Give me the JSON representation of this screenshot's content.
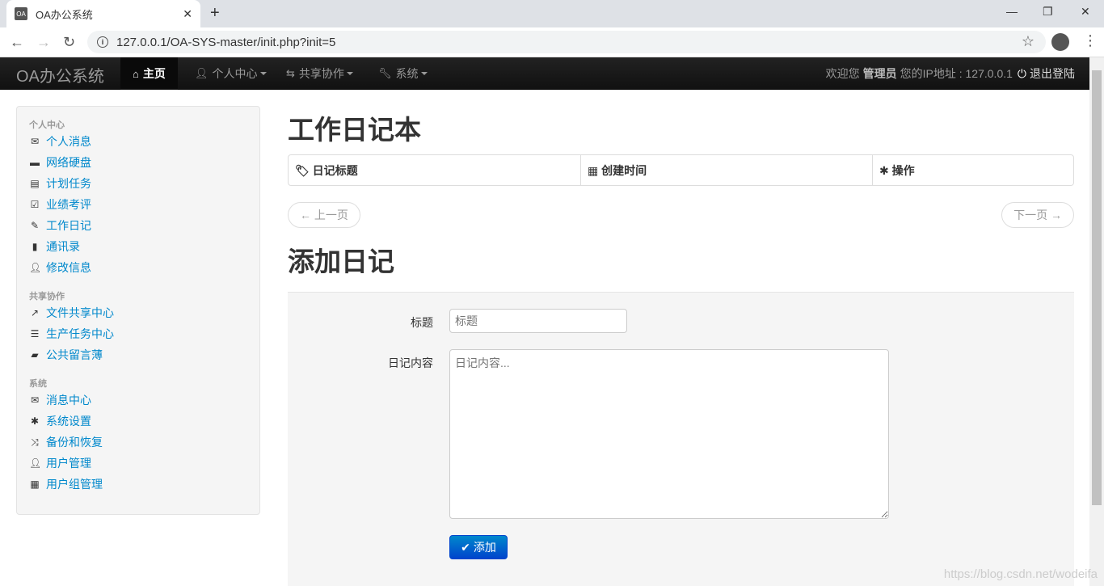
{
  "browser": {
    "tab_title": "OA办公系统",
    "favicon": "OA",
    "url": "127.0.0.1/OA-SYS-master/init.php?init=5"
  },
  "navbar": {
    "brand": "OA办公系统",
    "items": [
      {
        "label": "主页",
        "icon": "home-icon",
        "active": true
      },
      {
        "label": "个人中心",
        "icon": "user-icon"
      },
      {
        "label": "共享协作",
        "icon": "retweet-icon"
      },
      {
        "label": "系统",
        "icon": "wrench-icon"
      }
    ],
    "welcome": "欢迎您",
    "username": "管理员",
    "ip_label": "您的IP地址 : 127.0.0.1",
    "logout": "退出登陆"
  },
  "sidebar": {
    "groups": [
      {
        "header": "个人中心",
        "items": [
          {
            "label": "个人消息",
            "icon": "envelope-icon"
          },
          {
            "label": "网络硬盘",
            "icon": "hdd-icon"
          },
          {
            "label": "计划任务",
            "icon": "list-alt-icon"
          },
          {
            "label": "业绩考评",
            "icon": "check-icon"
          },
          {
            "label": "工作日记",
            "icon": "pencil-icon"
          },
          {
            "label": "通讯录",
            "icon": "book-icon"
          },
          {
            "label": "修改信息",
            "icon": "user-icon"
          }
        ]
      },
      {
        "header": "共享协作",
        "items": [
          {
            "label": "文件共享中心",
            "icon": "share-icon"
          },
          {
            "label": "生产任务中心",
            "icon": "tasks-icon"
          },
          {
            "label": "公共留言薄",
            "icon": "comment-icon"
          }
        ]
      },
      {
        "header": "系统",
        "items": [
          {
            "label": "消息中心",
            "icon": "envelope-icon"
          },
          {
            "label": "系统设置",
            "icon": "asterisk-icon"
          },
          {
            "label": "备份和恢复",
            "icon": "random-icon"
          },
          {
            "label": "用户管理",
            "icon": "user-icon"
          },
          {
            "label": "用户组管理",
            "icon": "th-large-icon"
          }
        ]
      }
    ]
  },
  "main": {
    "title": "工作日记本",
    "table_headers": [
      {
        "label": "日记标题",
        "icon": "tag-icon"
      },
      {
        "label": "创建时间",
        "icon": "calendar-icon"
      },
      {
        "label": "操作",
        "icon": "asterisk-icon"
      }
    ],
    "prev": "← 上一页",
    "next": "下一页 →",
    "add_title": "添加日记",
    "form": {
      "title_label": "标题",
      "title_placeholder": "标题",
      "content_label": "日记内容",
      "content_placeholder": "日记内容...",
      "submit": "添加"
    }
  },
  "watermark": "https://blog.csdn.net/wodeifa"
}
